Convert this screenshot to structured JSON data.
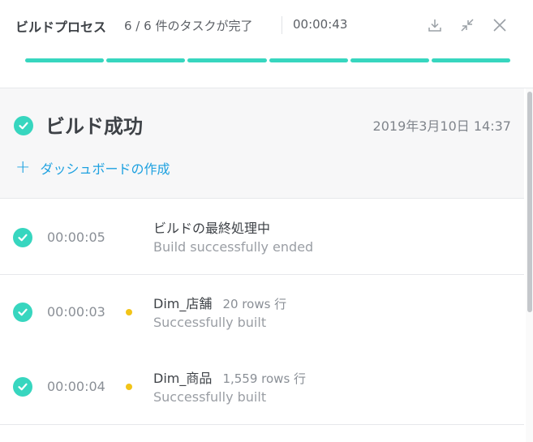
{
  "header": {
    "title": "ビルドプロセス",
    "progress_text": "6 / 6 件のタスクが完了",
    "elapsed": "00:00:43",
    "buttons": [
      "download-icon",
      "collapse-icon",
      "close-icon"
    ],
    "segments_total": 6,
    "segments_complete": 6,
    "accent_color": "#37d6bf"
  },
  "result": {
    "title": "ビルド成功",
    "date": "2019年3月10日 14:37",
    "create_dashboard_label": "ダッシュボードの作成",
    "status_icon": "check-circle-icon"
  },
  "steps": [
    {
      "time": "00:00:05",
      "name": "ビルドの最終処理中",
      "rows": "",
      "status": "Build successfully ended",
      "has_dot": false
    },
    {
      "time": "00:00:03",
      "name": "Dim_店舗",
      "rows": "20 rows 行",
      "status": "Successfully built",
      "has_dot": true
    },
    {
      "time": "00:00:04",
      "name": "Dim_商品",
      "rows": "1,559 rows 行",
      "status": "Successfully built",
      "has_dot": true
    }
  ],
  "colors": {
    "success": "#37d6bf",
    "link": "#1da1e0",
    "warning_dot": "#f2c418"
  }
}
